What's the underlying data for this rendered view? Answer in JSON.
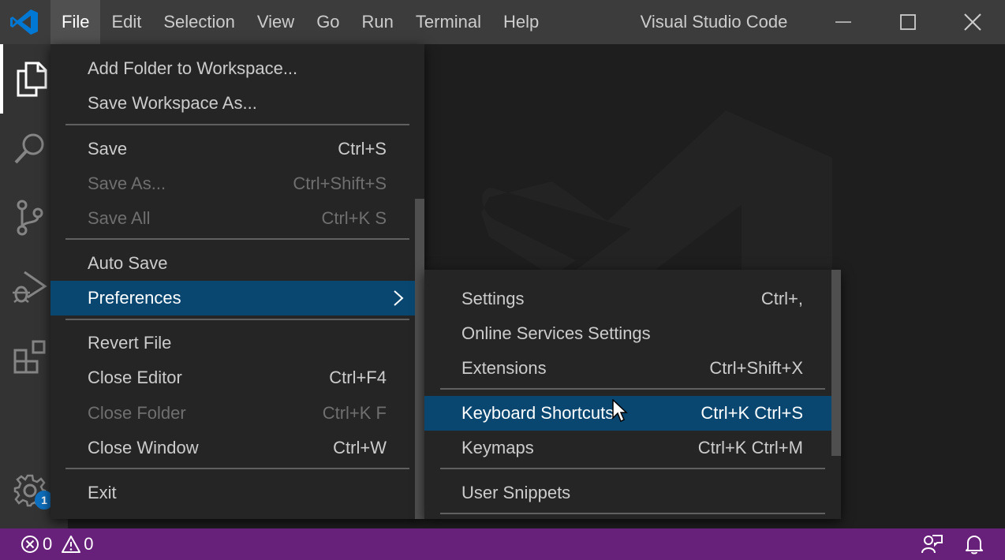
{
  "titlebar": {
    "menus": [
      "File",
      "Edit",
      "Selection",
      "View",
      "Go",
      "Run",
      "Terminal",
      "Help"
    ],
    "active_menu": "File",
    "window_title": "Visual Studio Code"
  },
  "activitybar": {
    "items": [
      "explorer",
      "search",
      "source-control",
      "run-debug",
      "extensions"
    ],
    "active": "explorer",
    "manage_badge": "1"
  },
  "file_menu": {
    "items": [
      {
        "label": "Add Folder to Workspace...",
        "shortcut": "",
        "disabled": false
      },
      {
        "label": "Save Workspace As...",
        "shortcut": "",
        "disabled": false
      },
      {
        "label": "Save",
        "shortcut": "Ctrl+S",
        "disabled": false
      },
      {
        "label": "Save As...",
        "shortcut": "Ctrl+Shift+S",
        "disabled": true
      },
      {
        "label": "Save All",
        "shortcut": "Ctrl+K S",
        "disabled": true
      },
      {
        "label": "Auto Save",
        "shortcut": "",
        "disabled": false
      },
      {
        "label": "Preferences",
        "shortcut": "",
        "disabled": false,
        "highlighted": true,
        "submenu": true
      },
      {
        "label": "Revert File",
        "shortcut": "",
        "disabled": false
      },
      {
        "label": "Close Editor",
        "shortcut": "Ctrl+F4",
        "disabled": false
      },
      {
        "label": "Close Folder",
        "shortcut": "Ctrl+K F",
        "disabled": true
      },
      {
        "label": "Close Window",
        "shortcut": "Ctrl+W",
        "disabled": false
      },
      {
        "label": "Exit",
        "shortcut": "",
        "disabled": false
      }
    ]
  },
  "preferences_menu": {
    "items": [
      {
        "label": "Settings",
        "shortcut": "Ctrl+,"
      },
      {
        "label": "Online Services Settings",
        "shortcut": ""
      },
      {
        "label": "Extensions",
        "shortcut": "Ctrl+Shift+X"
      },
      {
        "label": "Keyboard Shortcuts",
        "shortcut": "Ctrl+K Ctrl+S",
        "highlighted": true
      },
      {
        "label": "Keymaps",
        "shortcut": "Ctrl+K Ctrl+M"
      },
      {
        "label": "User Snippets",
        "shortcut": ""
      }
    ]
  },
  "statusbar": {
    "errors": "0",
    "warnings": "0"
  },
  "colors": {
    "statusbar_bg": "#68217a",
    "menu_highlight": "#094771",
    "titlebar_bg": "#3c3c3c",
    "activitybar_bg": "#333333",
    "menu_bg": "#252526",
    "logo_blue": "#0078d4"
  }
}
